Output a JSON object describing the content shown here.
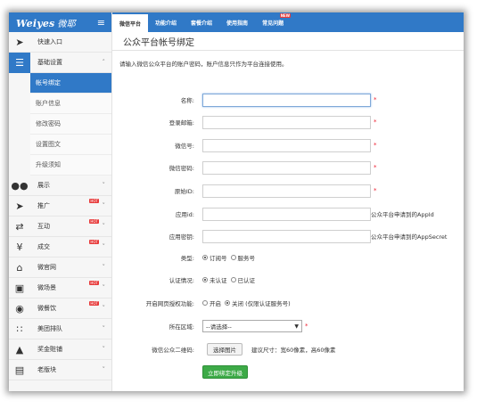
{
  "logo": {
    "brand": "Weiyes",
    "cn": "微耶",
    "menu_icon": "hamburger-icon"
  },
  "tabs": [
    {
      "label": "微信平台",
      "active": true
    },
    {
      "label": "功能介绍"
    },
    {
      "label": "套餐介绍"
    },
    {
      "label": "使用指南"
    },
    {
      "label": "常见问题",
      "badge": "NEW"
    }
  ],
  "sidebar": {
    "quick": {
      "label": "快速入口",
      "icon": "rocket-icon"
    },
    "basic": {
      "label": "基础设置",
      "icon": "list-icon"
    },
    "sub": [
      "帐号绑定",
      "账户信息",
      "修改密码",
      "设置图文",
      "升级须知"
    ],
    "items": [
      {
        "label": "展示",
        "icon": "users-icon"
      },
      {
        "label": "推广",
        "icon": "plane-icon",
        "hot": "HOT"
      },
      {
        "label": "互动",
        "icon": "shuffle-icon",
        "hot": "HOT"
      },
      {
        "label": "成交",
        "icon": "yen-icon",
        "hot": "HOT"
      },
      {
        "label": "微官网",
        "icon": "home-icon"
      },
      {
        "label": "微场景",
        "icon": "picture-icon",
        "hot": "HOT"
      },
      {
        "label": "微餐饮",
        "icon": "globe-icon",
        "hot": "HOT"
      },
      {
        "label": "美团排队",
        "icon": "spinner-icon"
      },
      {
        "label": "奖金赃铺",
        "icon": "trophy-icon"
      },
      {
        "label": "老版块",
        "icon": "film-icon"
      }
    ]
  },
  "page": {
    "title": "公众平台帐号绑定",
    "hint": "请输入微信公众平台的账户密码，账户信息只作为平台连接使用。"
  },
  "form": {
    "name_label": "名称:",
    "email_label": "登录邮箱:",
    "wechat_label": "微信号:",
    "password_label": "微信密码:",
    "origin_label": "原始ID:",
    "appid_label": "应用id:",
    "appid_note": "公众平台申请到的AppId",
    "secret_label": "应用密钥:",
    "secret_note": "公众平台申请到的AppSecret",
    "type_label": "类型:",
    "type_opts": [
      "订阅号",
      "服务号"
    ],
    "verify_label": "认证情况:",
    "verify_opts": [
      "未认证",
      "已认证"
    ],
    "oauth_label": "开启网页授权功能:",
    "oauth_opts": [
      "开启",
      "关闭 (仅限认证服务号)"
    ],
    "region_label": "所在区域:",
    "region_value": "--请选择--",
    "qrcode_label": "微信公众二维码:",
    "upload_label": "选择图片",
    "upload_note": "建议尺寸：宽60像素，高60像素",
    "submit_label": "立即绑定升级",
    "required_mark": "*"
  }
}
